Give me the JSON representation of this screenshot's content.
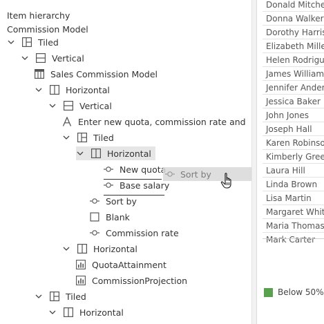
{
  "panel_title": "Item hierarchy",
  "model_name": "Commission Model",
  "tree": [
    {
      "label": "Tiled",
      "icon": "tiled-icon",
      "chevron": "down"
    },
    {
      "label": "Vertical",
      "icon": "vertical-layout-icon",
      "chevron": "down"
    },
    {
      "label": "Sales Commission Model",
      "icon": "table-header-icon",
      "chevron": ""
    },
    {
      "label": "Horizontal",
      "icon": "horizontal-layout-icon",
      "chevron": "down"
    },
    {
      "label": "Vertical",
      "icon": "vertical-layout-icon",
      "chevron": "down"
    },
    {
      "label": "Enter new quota, commission rate and",
      "icon": "text-icon",
      "chevron": ""
    },
    {
      "label": "Tiled",
      "icon": "tiled-icon",
      "chevron": "down"
    },
    {
      "label": "Horizontal",
      "icon": "horizontal-layout-icon",
      "chevron": "down",
      "selected": true
    },
    {
      "label": "New quota",
      "icon": "parameter-icon",
      "chevron": ""
    },
    {
      "label": "Base salary",
      "icon": "parameter-icon",
      "chevron": ""
    },
    {
      "label": "Sort by",
      "icon": "parameter-icon",
      "chevron": ""
    },
    {
      "label": "Blank",
      "icon": "blank-icon",
      "chevron": ""
    },
    {
      "label": "Commission rate",
      "icon": "parameter-icon",
      "chevron": ""
    },
    {
      "label": "Horizontal",
      "icon": "horizontal-layout-icon",
      "chevron": "down"
    },
    {
      "label": "QuotaAttainment",
      "icon": "sheet-icon",
      "chevron": ""
    },
    {
      "label": "CommissionProjection",
      "icon": "sheet-icon",
      "chevron": ""
    },
    {
      "label": "Tiled",
      "icon": "tiled-icon",
      "chevron": "down"
    },
    {
      "label": "Horizontal",
      "icon": "horizontal-layout-icon",
      "chevron": "down"
    }
  ],
  "drag_ghost": {
    "label": "Sort by",
    "icon": "parameter-icon"
  },
  "names": [
    "Donald Mitchell",
    "Donna Walker",
    "Dorothy Harris",
    "Elizabeth Miller",
    "Helen Rodriguez",
    "James Williams",
    "Jennifer Anderson",
    "Jessica Baker",
    "John Jones",
    "Joseph Hall",
    "Karen Robinson",
    "Kimberly Green",
    "Laura Hill",
    "Linda Brown",
    "Lisa Martin",
    "Margaret White",
    "Maria Thomas",
    "Mark Carter"
  ],
  "legend": {
    "label": "Below 50%",
    "color": "#59a14f"
  },
  "colors": {
    "selected_bg": "#e6e6e6",
    "divider": "#f2f2f2",
    "icon": "#555555"
  }
}
